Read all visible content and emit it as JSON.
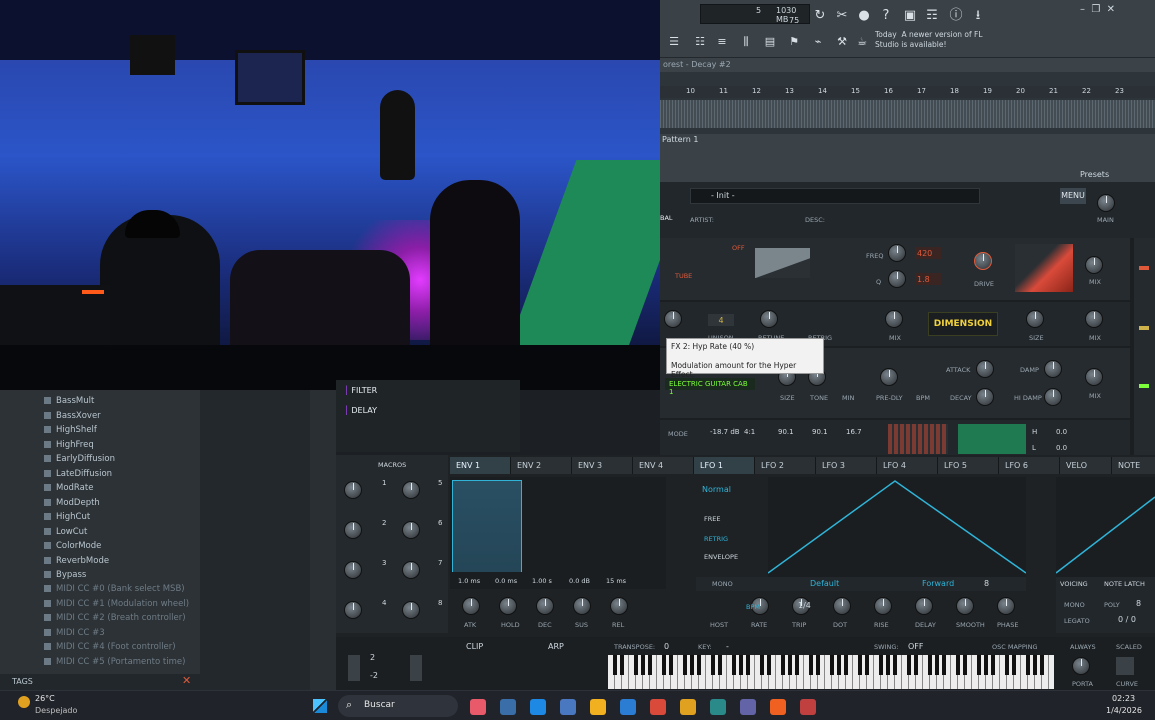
{
  "fl_top": {
    "mem": "1030 MB",
    "mem_sub": "75",
    "cpu_num": "5",
    "notice_today": "Today",
    "notice_text": "A newer version of FL Studio is available!"
  },
  "playlist": {
    "title": "orest - Decay #2",
    "ruler": [
      "10",
      "11",
      "12",
      "13",
      "14",
      "15",
      "16",
      "17",
      "18",
      "19",
      "20",
      "21",
      "22",
      "23"
    ],
    "pattern": "Pattern 1"
  },
  "plugin": {
    "presets_label": "Presets",
    "preset_name": "- Init -",
    "menu_label": "MENU",
    "main_label": "MAIN",
    "artist_label": "ARTIST:",
    "desc_label": "DESC:",
    "global_label": "BAL"
  },
  "fx": {
    "tube": "TUBE",
    "off": "OFF",
    "freq_label": "FREQ",
    "q_label": "Q",
    "freq_val": "420",
    "q_val": "1.8",
    "drive_label": "DRIVE",
    "mix_label": "MIX",
    "hyper_num": "4",
    "unison_label": "UNISON",
    "retune_label": "RETUNE",
    "retrig_label": "RETRIG",
    "dimension_label": "DIMENSION",
    "size_label": "SIZE",
    "tooltip_title": "FX 2: Hyp Rate (40 %)",
    "tooltip_text": "Modulation amount for the Hyper Effect.",
    "guitar_label": "ELECTRIC GUITAR CAB 1",
    "tone_label": "TONE",
    "min_label": "MIN",
    "predly_label": "PRE-DLY",
    "bpm_label": "BPM",
    "attack_label": "ATTACK",
    "decay_label": "DECAY",
    "damp_label": "DAMP",
    "hi_damp_label": "HI DAMP",
    "mode_label": "MODE",
    "comp_vals": [
      "-18.7 dB",
      "4:1",
      "90.1",
      "90.1",
      "16.7"
    ],
    "meter_vals": [
      "H",
      "0.0",
      "L",
      "0.0"
    ]
  },
  "fxlist": {
    "items": [
      "FILTER",
      "DELAY"
    ]
  },
  "browser": {
    "items": [
      "BassMult",
      "BassXover",
      "HighShelf",
      "HighFreq",
      "EarlyDiffusion",
      "LateDiffusion",
      "ModRate",
      "ModDepth",
      "HighCut",
      "LowCut",
      "ColorMode",
      "ReverbMode",
      "Bypass"
    ],
    "midi_items": [
      "MIDI CC #0 (Bank select MSB)",
      "MIDI CC #1 (Modulation wheel)",
      "MIDI CC #2 (Breath controller)",
      "MIDI CC #3",
      "MIDI CC #4 (Foot controller)",
      "MIDI CC #5 (Portamento time)"
    ],
    "tags_label": "TAGS"
  },
  "mod": {
    "macros_label": "MACROS",
    "macro_nums": [
      "1",
      "5",
      "2",
      "6",
      "3",
      "7",
      "4",
      "8"
    ],
    "tabs": [
      "ENV 1",
      "ENV 2",
      "ENV 3",
      "ENV 4",
      "LFO 1",
      "LFO 2",
      "LFO 3",
      "LFO 4",
      "LFO 5",
      "LFO 6",
      "VELO",
      "NOTE"
    ],
    "env_vals": [
      "1.0 ms",
      "0.0 ms",
      "1.00 s",
      "0.0 dB",
      "15 ms"
    ],
    "env_knobs": [
      "ATK",
      "HOLD",
      "DEC",
      "SUS",
      "REL"
    ],
    "lfo_mode": "Normal",
    "lfo_trig": [
      "FREE",
      "RETRIG",
      "ENVELOPE"
    ],
    "lfo_mono": "MONO",
    "lfo_shape": "Default",
    "lfo_dir": "Forward",
    "lfo_grid": "8",
    "lfo_bpm": "BPM",
    "lfo_rate": "1/4",
    "lfo_knobs": [
      "HOST",
      "RATE",
      "TRIP",
      "DOT",
      "RISE",
      "DELAY",
      "SMOOTH",
      "PHASE"
    ],
    "voicing_label": "VOICING",
    "note_latch": "NOTE LATCH",
    "mono_label": "MONO",
    "poly_label": "POLY",
    "poly_val": "8",
    "legato_label": "LEGATO",
    "legato_val": "0 / 0",
    "clip_label": "CLIP",
    "arp_label": "ARP",
    "transpose_label": "TRANSPOSE:",
    "transpose_val": "0",
    "key_label": "KEY:",
    "key_val": "-",
    "swing_label": "SWING:",
    "swing_val": "OFF",
    "osc_mapping": "OSC MAPPING",
    "always_label": "ALWAYS",
    "scaled_label": "SCALED",
    "porta_label": "PORTA",
    "curve_label": "CURVE",
    "pb_up": "2",
    "pb_down": "-2"
  },
  "taskbar": {
    "temp": "26°C",
    "weather": "Despejado",
    "search": "Buscar",
    "time": "02:23",
    "date": "1/4/2026"
  },
  "colors": {
    "accent": "#2fb4d8",
    "warning_red": "#d94a3a",
    "neon_green": "#7cff3a"
  }
}
